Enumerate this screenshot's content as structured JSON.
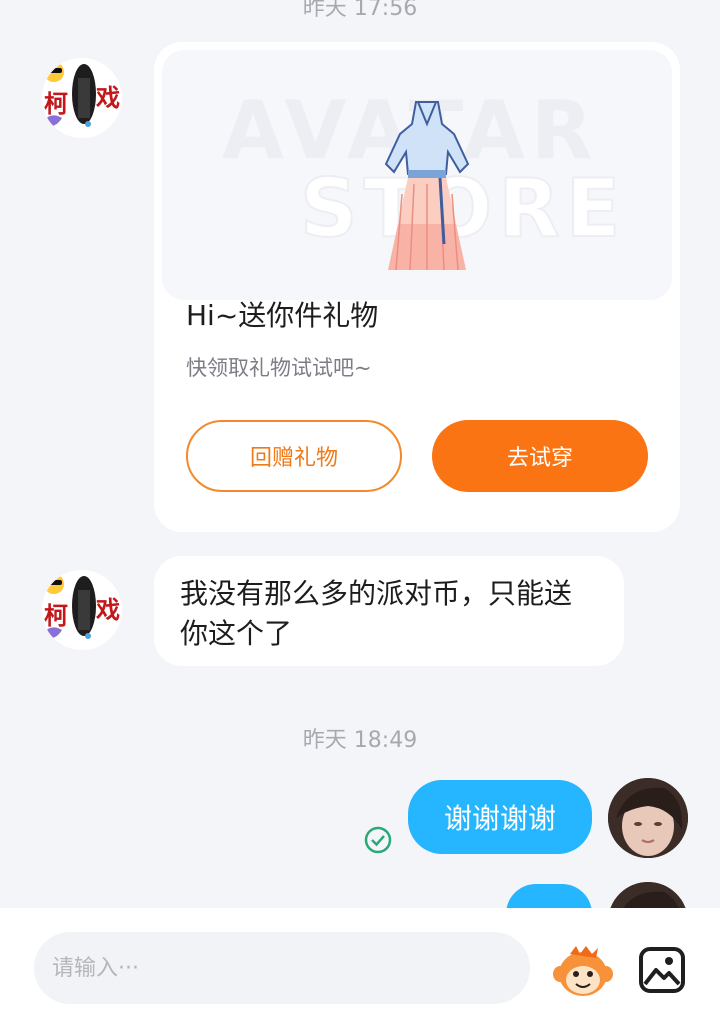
{
  "timestamps": {
    "top": "昨天 17:56",
    "middle": "昨天 18:49"
  },
  "gift_card": {
    "banner_watermark_line1": "AVATAR",
    "banner_watermark_line2": "STORE",
    "title": "Hi~送你件礼物",
    "subtitle": "快领取礼物试试吧~",
    "return_gift_label": "回赠礼物",
    "try_on_label": "去试穿"
  },
  "messages": {
    "incoming_text": "我没有那么多的派对币，只能送你这个了",
    "outgoing_1": "谢谢谢谢",
    "outgoing_2": "",
    "outgoing_1_status": "delivered"
  },
  "avatar_text": {
    "left_char": "柯",
    "right_char": "戏"
  },
  "input_bar": {
    "placeholder": "请输入···"
  },
  "colors": {
    "accent_orange": "#fa7413",
    "outgoing_bubble": "#26b5ff",
    "read_check": "#2aa876"
  }
}
